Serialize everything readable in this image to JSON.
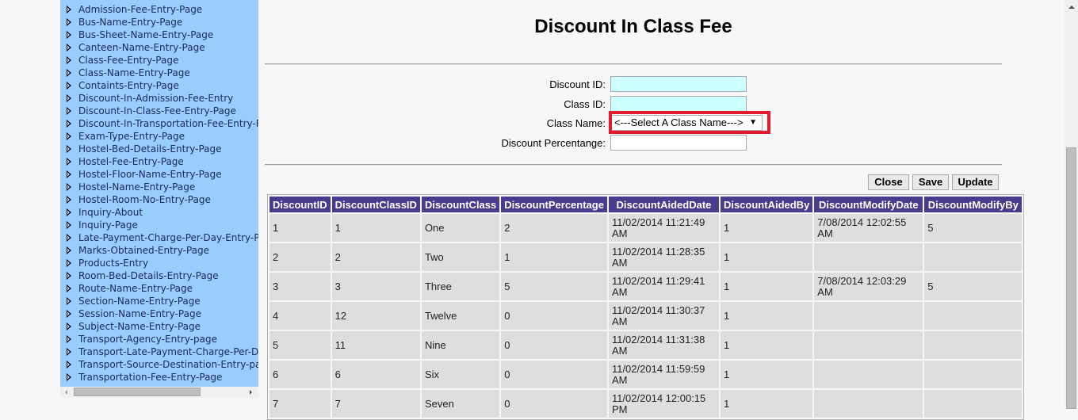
{
  "sidebar": {
    "items": [
      {
        "label": "Admission-Fee-Entry-Page"
      },
      {
        "label": "Bus-Name-Entry-Page"
      },
      {
        "label": "Bus-Sheet-Name-Entry-Page"
      },
      {
        "label": "Canteen-Name-Entry-Page"
      },
      {
        "label": "Class-Fee-Entry-Page"
      },
      {
        "label": "Class-Name-Entry-Page"
      },
      {
        "label": "Containts-Entry-Page"
      },
      {
        "label": "Discount-In-Admission-Fee-Entry"
      },
      {
        "label": "Discount-In-Class-Fee-Entry-Page"
      },
      {
        "label": "Discount-In-Transportation-Fee-Entry-Page"
      },
      {
        "label": "Exam-Type-Entry-Page"
      },
      {
        "label": "Hostel-Bed-Details-Entry-Page"
      },
      {
        "label": "Hostel-Fee-Entry-Page"
      },
      {
        "label": "Hostel-Floor-Name-Entry-Page"
      },
      {
        "label": "Hostel-Name-Entry-Page"
      },
      {
        "label": "Hostel-Room-No-Entry-Page"
      },
      {
        "label": "Inquiry-About"
      },
      {
        "label": "Inquiry-Page"
      },
      {
        "label": "Late-Payment-Charge-Per-Day-Entry-Page"
      },
      {
        "label": "Marks-Obtained-Entry-Page"
      },
      {
        "label": "Products-Entry"
      },
      {
        "label": "Room-Bed-Details-Entry-Page"
      },
      {
        "label": "Route-Name-Entry-Page"
      },
      {
        "label": "Section-Name-Entry-Page"
      },
      {
        "label": "Session-Name-Entry-Page"
      },
      {
        "label": "Subject-Name-Entry-Page"
      },
      {
        "label": "Transport-Agency-Entry-page"
      },
      {
        "label": "Transport-Late-Payment-Charge-Per-Day"
      },
      {
        "label": "Transport-Source-Destination-Entry-page"
      },
      {
        "label": "Transportation-Fee-Entry-Page"
      }
    ]
  },
  "page": {
    "title": "Discount In Class Fee"
  },
  "form": {
    "discount_id_label": "Discount ID:",
    "discount_id_value": "",
    "class_id_label": "Class ID:",
    "class_id_value": "",
    "class_name_label": "Class Name:",
    "class_name_selected": "<---Select A Class Name--->",
    "discount_percentage_label": "Discount Percentange:",
    "discount_percentage_value": ""
  },
  "toolbar": {
    "close_label": "Close",
    "save_label": "Save",
    "update_label": "Update"
  },
  "table": {
    "headers": [
      "DiscountID",
      "DiscountClassID",
      "DiscountClass",
      "DiscountPercentage",
      "DiscountAidedDate",
      "DiscountAidedBy",
      "DiscountModifyDate",
      "DiscountModifyBy"
    ],
    "rows": [
      [
        "1",
        "1",
        "One",
        "2",
        "11/02/2014 11:21:49 AM",
        "1",
        "7/08/2014 12:02:55 AM",
        "5"
      ],
      [
        "2",
        "2",
        "Two",
        "1",
        "11/02/2014 11:28:35 AM",
        "1",
        "",
        ""
      ],
      [
        "3",
        "3",
        "Three",
        "5",
        "11/02/2014 11:29:41 AM",
        "1",
        "7/08/2014 12:03:29 AM",
        "5"
      ],
      [
        "4",
        "12",
        "Twelve",
        "0",
        "11/02/2014 11:30:37 AM",
        "1",
        "",
        ""
      ],
      [
        "5",
        "11",
        "Nine",
        "0",
        "11/02/2014 11:31:38 AM",
        "1",
        "",
        ""
      ],
      [
        "6",
        "6",
        "Six",
        "0",
        "11/02/2014 11:59:59 AM",
        "1",
        "",
        ""
      ],
      [
        "7",
        "7",
        "Seven",
        "0",
        "11/02/2014 12:00:15 PM",
        "1",
        "",
        ""
      ]
    ]
  },
  "colors": {
    "sidebar_bg": "#99ccff",
    "header_bg": "#4a3c8c",
    "input_bg": "#ccffff",
    "highlight": "#e3192e"
  }
}
